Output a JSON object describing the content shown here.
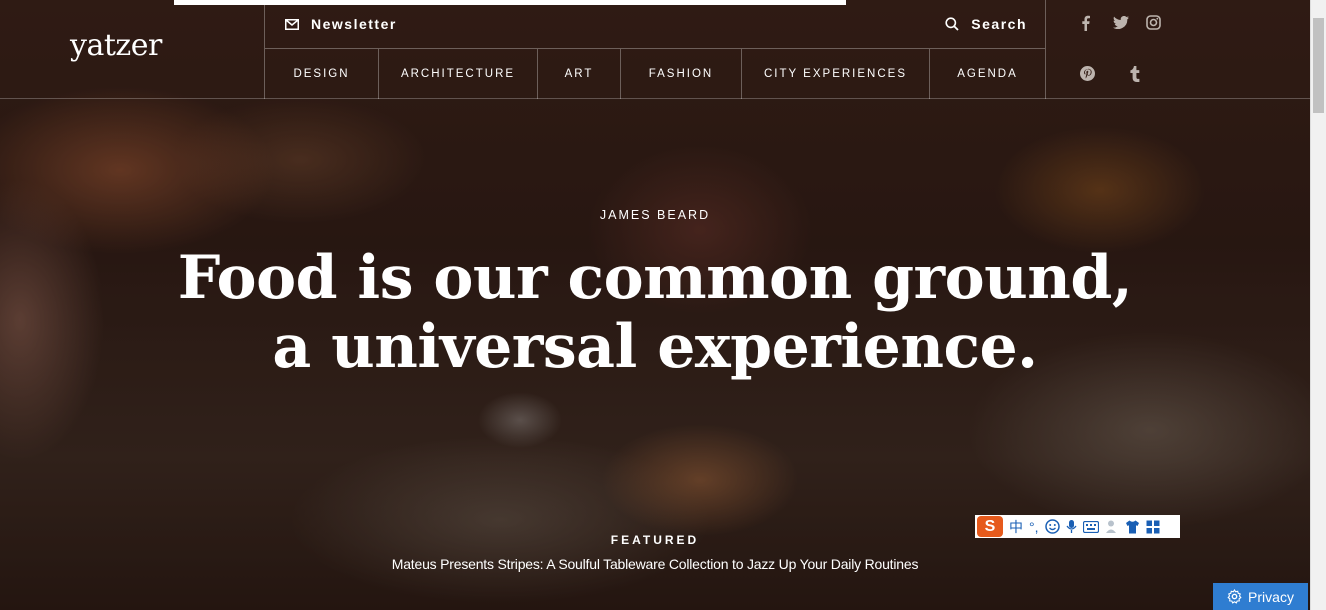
{
  "site": {
    "logo": "yatzer"
  },
  "header": {
    "newsletter_label": "Newsletter",
    "search_label": "Search",
    "nav": [
      "DESIGN",
      "ARCHITECTURE",
      "ART",
      "FASHION",
      "CITY EXPERIENCES",
      "AGENDA"
    ],
    "social_icons": [
      "facebook-icon",
      "twitter-icon",
      "instagram-icon",
      "pinterest-icon",
      "tumblr-icon"
    ]
  },
  "hero": {
    "kicker": "JAMES BEARD",
    "headline": "Food is our common ground, a universal experience."
  },
  "featured": {
    "label": "FEATURED",
    "title": "Mateus Presents Stripes: A Soulful Tableware Collection to Jazz Up Your Daily Routines"
  },
  "ime_toolbar": {
    "logo": "S",
    "mode": "中",
    "punct": "°,"
  },
  "privacy": {
    "label": "Privacy"
  },
  "colors": {
    "privacy_blue": "#2f7dd1",
    "ime_orange": "#e65a1c"
  }
}
